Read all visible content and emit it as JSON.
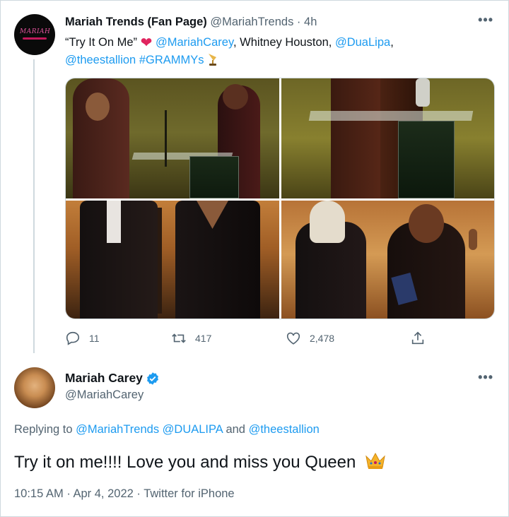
{
  "quoted_tweet": {
    "author_name": "Mariah Trends (Fan Page)",
    "author_handle": "@MariahTrends",
    "separator": "·",
    "age": "4h",
    "avatar_text": "MARIAH",
    "text_part1": "“Try It On Me” ",
    "mention1": "@MariahCarey",
    "text_part2": ", Whitney Houston, ",
    "mention2": "@DuaLipa",
    "text_part3": ",",
    "mention3": "@theestallion",
    "hashtag": "#GRAMMYs",
    "media_count": 4,
    "stats": {
      "replies": "11",
      "retweets": "417",
      "likes": "2,478"
    }
  },
  "reply_tweet": {
    "author_name": "Mariah Carey",
    "author_handle": "@MariahCarey",
    "replying_label": "Replying to ",
    "replying_mentions": "@MariahTrends @DUALIPA",
    "replying_and": " and ",
    "replying_last": "@theestallion",
    "text": "Try it on me!!!! Love you and miss you Queen",
    "time": "10:15 AM",
    "date": "Apr 4, 2022",
    "source": "Twitter for iPhone",
    "dot": "·"
  },
  "more_label": "•••",
  "colors": {
    "accent": "#1d9bf0",
    "text": "#0f1419",
    "secondary": "#536471",
    "heart": "#e0245e",
    "border": "#cfd9de"
  },
  "icons": [
    "reply-icon",
    "retweet-icon",
    "like-icon",
    "share-icon",
    "verified-icon",
    "heart-emoji-icon",
    "gramophone-emoji-icon",
    "crown-emoji-icon",
    "more-icon"
  ]
}
